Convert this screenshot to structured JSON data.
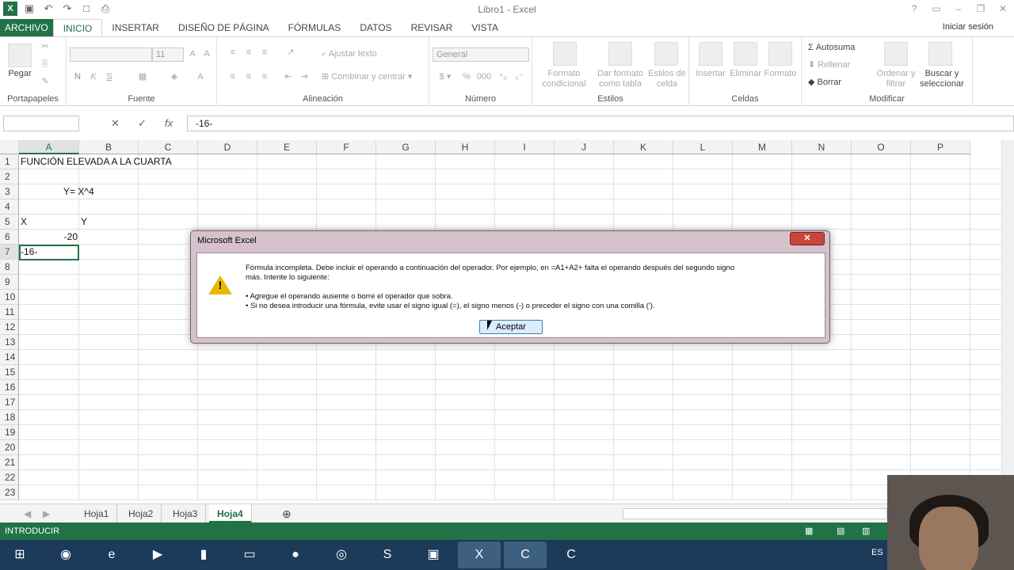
{
  "window": {
    "title": "Libro1 - Excel"
  },
  "ribbon_tabs": [
    "ARCHIVO",
    "INICIO",
    "INSERTAR",
    "DISEÑO DE PÁGINA",
    "FÓRMULAS",
    "DATOS",
    "REVISAR",
    "VISTA"
  ],
  "signin": "Iniciar sesión",
  "ribbon": {
    "paste": "Pegar",
    "font_size": "11",
    "wrap_text": "Ajustar texto",
    "merge_center": "Combinar y centrar",
    "number_format": "General",
    "cond_format": "Formato condicional",
    "format_table": "Dar formato como tabla",
    "cell_styles": "Estilos de celda",
    "insert": "Insertar",
    "delete": "Eliminar",
    "format": "Formato",
    "autosum": "Autosuma",
    "fill": "Rellenar",
    "clear": "Borrar",
    "sort": "Ordenar y filtrar",
    "find": "Buscar y seleccionar",
    "groups": {
      "clipboard": "Portapapeles",
      "font": "Fuente",
      "alignment": "Alineación",
      "number": "Número",
      "styles": "Estilos",
      "cells": "Celdas",
      "editing": "Modificar"
    }
  },
  "formula_bar": {
    "fx": "fx",
    "value": "-16-"
  },
  "columns": [
    "A",
    "B",
    "C",
    "D",
    "E",
    "F",
    "G",
    "H",
    "I",
    "J",
    "K",
    "L",
    "M",
    "N",
    "O",
    "P"
  ],
  "rows": [
    "1",
    "2",
    "3",
    "4",
    "5",
    "6",
    "7",
    "8",
    "9",
    "10",
    "11",
    "12",
    "13",
    "14",
    "15",
    "16",
    "17",
    "18",
    "19",
    "20",
    "21",
    "22",
    "23"
  ],
  "cells": {
    "A1": "FUNCIÓN ELEVADA A LA CUARTA",
    "A3": "Y= X^4",
    "A5": "X",
    "B5": "Y",
    "A6": "-20",
    "A7": "-16-"
  },
  "sheet_tabs": [
    "Hoja1",
    "Hoja2",
    "Hoja3",
    "Hoja4"
  ],
  "status": "INTRODUCIR",
  "taskbar": {
    "lang": "ES"
  },
  "dialog": {
    "title": "Microsoft Excel",
    "line1": "Fórmula incompleta. Debe incluir el operando a continuación del operador. Por ejemplo, en =A1+A2+ falta el operando después del segundo signo",
    "line2": "más. Intente lo siguiente:",
    "bullet1": "• Agregue el operando ausente o borre el operador que sobra.",
    "bullet2": "• Si no desea introducir una fórmula, evite usar el signo igual (=), el signo menos (-) o preceder el signo con una comilla (').",
    "ok": "Aceptar"
  },
  "colors": {
    "excel_green": "#217346",
    "dialog_frame": "#d6c2cc",
    "warning": "#e8b800"
  }
}
